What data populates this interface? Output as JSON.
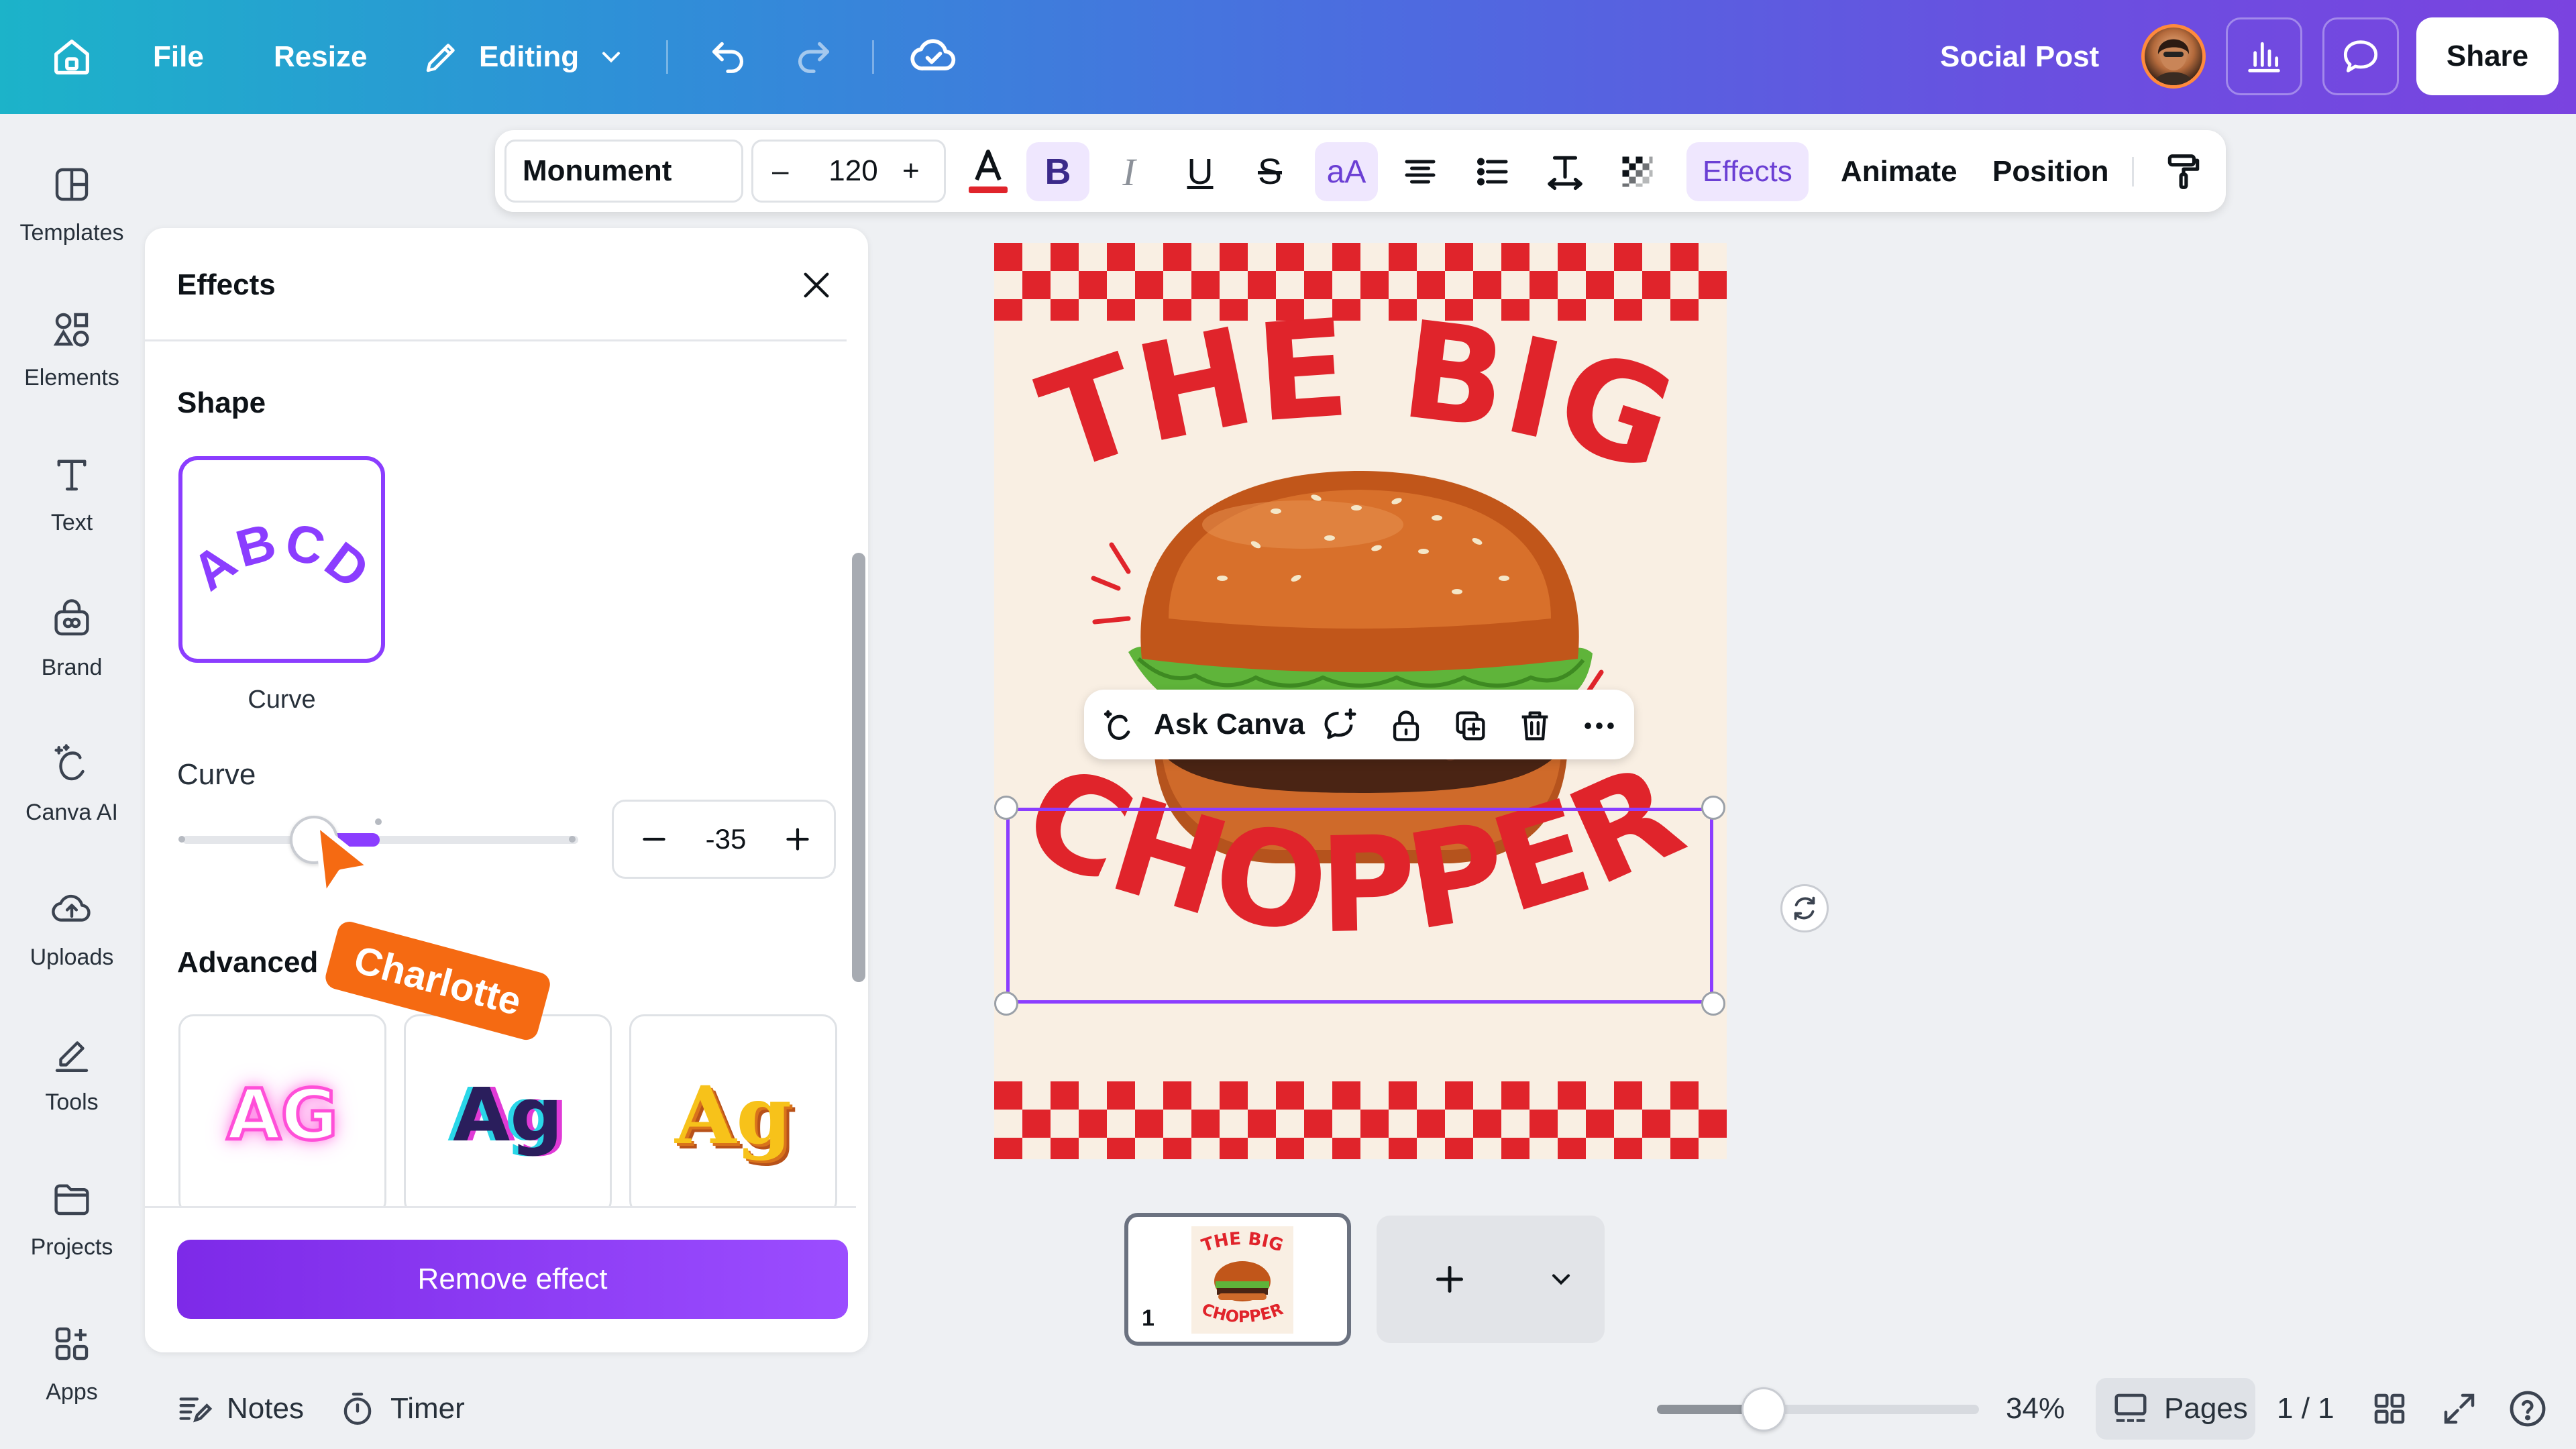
{
  "topbar": {
    "file_label": "File",
    "resize_label": "Resize",
    "editing_label": "Editing",
    "doc_title": "Social Post",
    "share_label": "Share"
  },
  "sidebar": {
    "items": [
      {
        "label": "Templates",
        "icon": "templates-icon"
      },
      {
        "label": "Elements",
        "icon": "elements-icon"
      },
      {
        "label": "Text",
        "icon": "text-icon"
      },
      {
        "label": "Brand",
        "icon": "brand-icon"
      },
      {
        "label": "Canva AI",
        "icon": "canva-ai-icon"
      },
      {
        "label": "Uploads",
        "icon": "uploads-icon"
      },
      {
        "label": "Tools",
        "icon": "tools-icon"
      },
      {
        "label": "Projects",
        "icon": "projects-icon"
      },
      {
        "label": "Apps",
        "icon": "apps-icon"
      }
    ]
  },
  "text_toolbar": {
    "font": "Monument",
    "font_size": "120",
    "case_label": "aA",
    "effects_label": "Effects",
    "animate_label": "Animate",
    "position_label": "Position",
    "text_color": "#e0242b"
  },
  "effects_panel": {
    "title": "Effects",
    "shape_section": "Shape",
    "shape_sample": "ABCD",
    "shape_name": "Curve",
    "curve_label": "Curve",
    "curve_value": "-35",
    "advanced_section": "Advanced",
    "advanced_samples": [
      "AG",
      "Ag",
      "Ag"
    ],
    "remove_label": "Remove effect"
  },
  "collaborator": {
    "name": "Charlotte",
    "color": "#f56a12"
  },
  "design": {
    "line1": "THE BIG",
    "line2": "CHOPPER",
    "text_color": "#e0242b",
    "background": "#f9efe3"
  },
  "context_toolbar": {
    "ask_label": "Ask Canva"
  },
  "pages": {
    "thumb_number": "1",
    "thumb_line1": "THE BIG",
    "thumb_line2": "CHOPPER"
  },
  "bottom_bar": {
    "notes_label": "Notes",
    "timer_label": "Timer",
    "zoom": "34%",
    "pages_label": "Pages",
    "page_count": "1 / 1"
  },
  "colors": {
    "accent": "#8b3dff",
    "brand_gradient_start": "#1cb3c9",
    "brand_gradient_end": "#7a43e0"
  }
}
